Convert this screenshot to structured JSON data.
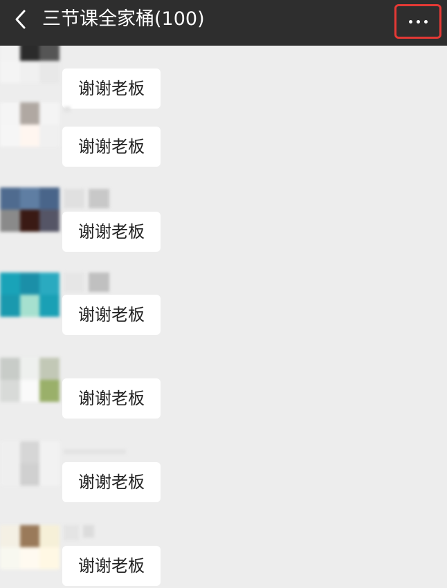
{
  "header": {
    "title": "三节课全家桶(100)",
    "back_icon": "chevron-left-icon",
    "more_icon": "ellipsis-icon",
    "more_highlight_color": "#e53935"
  },
  "colors": {
    "topbar_bg": "#2e2e2e",
    "chat_bg": "#ededed",
    "bubble_bg": "#ffffff"
  },
  "messages": [
    {
      "text": "谢谢老板"
    },
    {
      "text": "谢谢老板"
    },
    {
      "text": "谢谢老板"
    },
    {
      "text": "谢谢老板"
    },
    {
      "text": "谢谢老板"
    },
    {
      "text": "谢谢老板"
    },
    {
      "text": "谢谢老板"
    }
  ]
}
